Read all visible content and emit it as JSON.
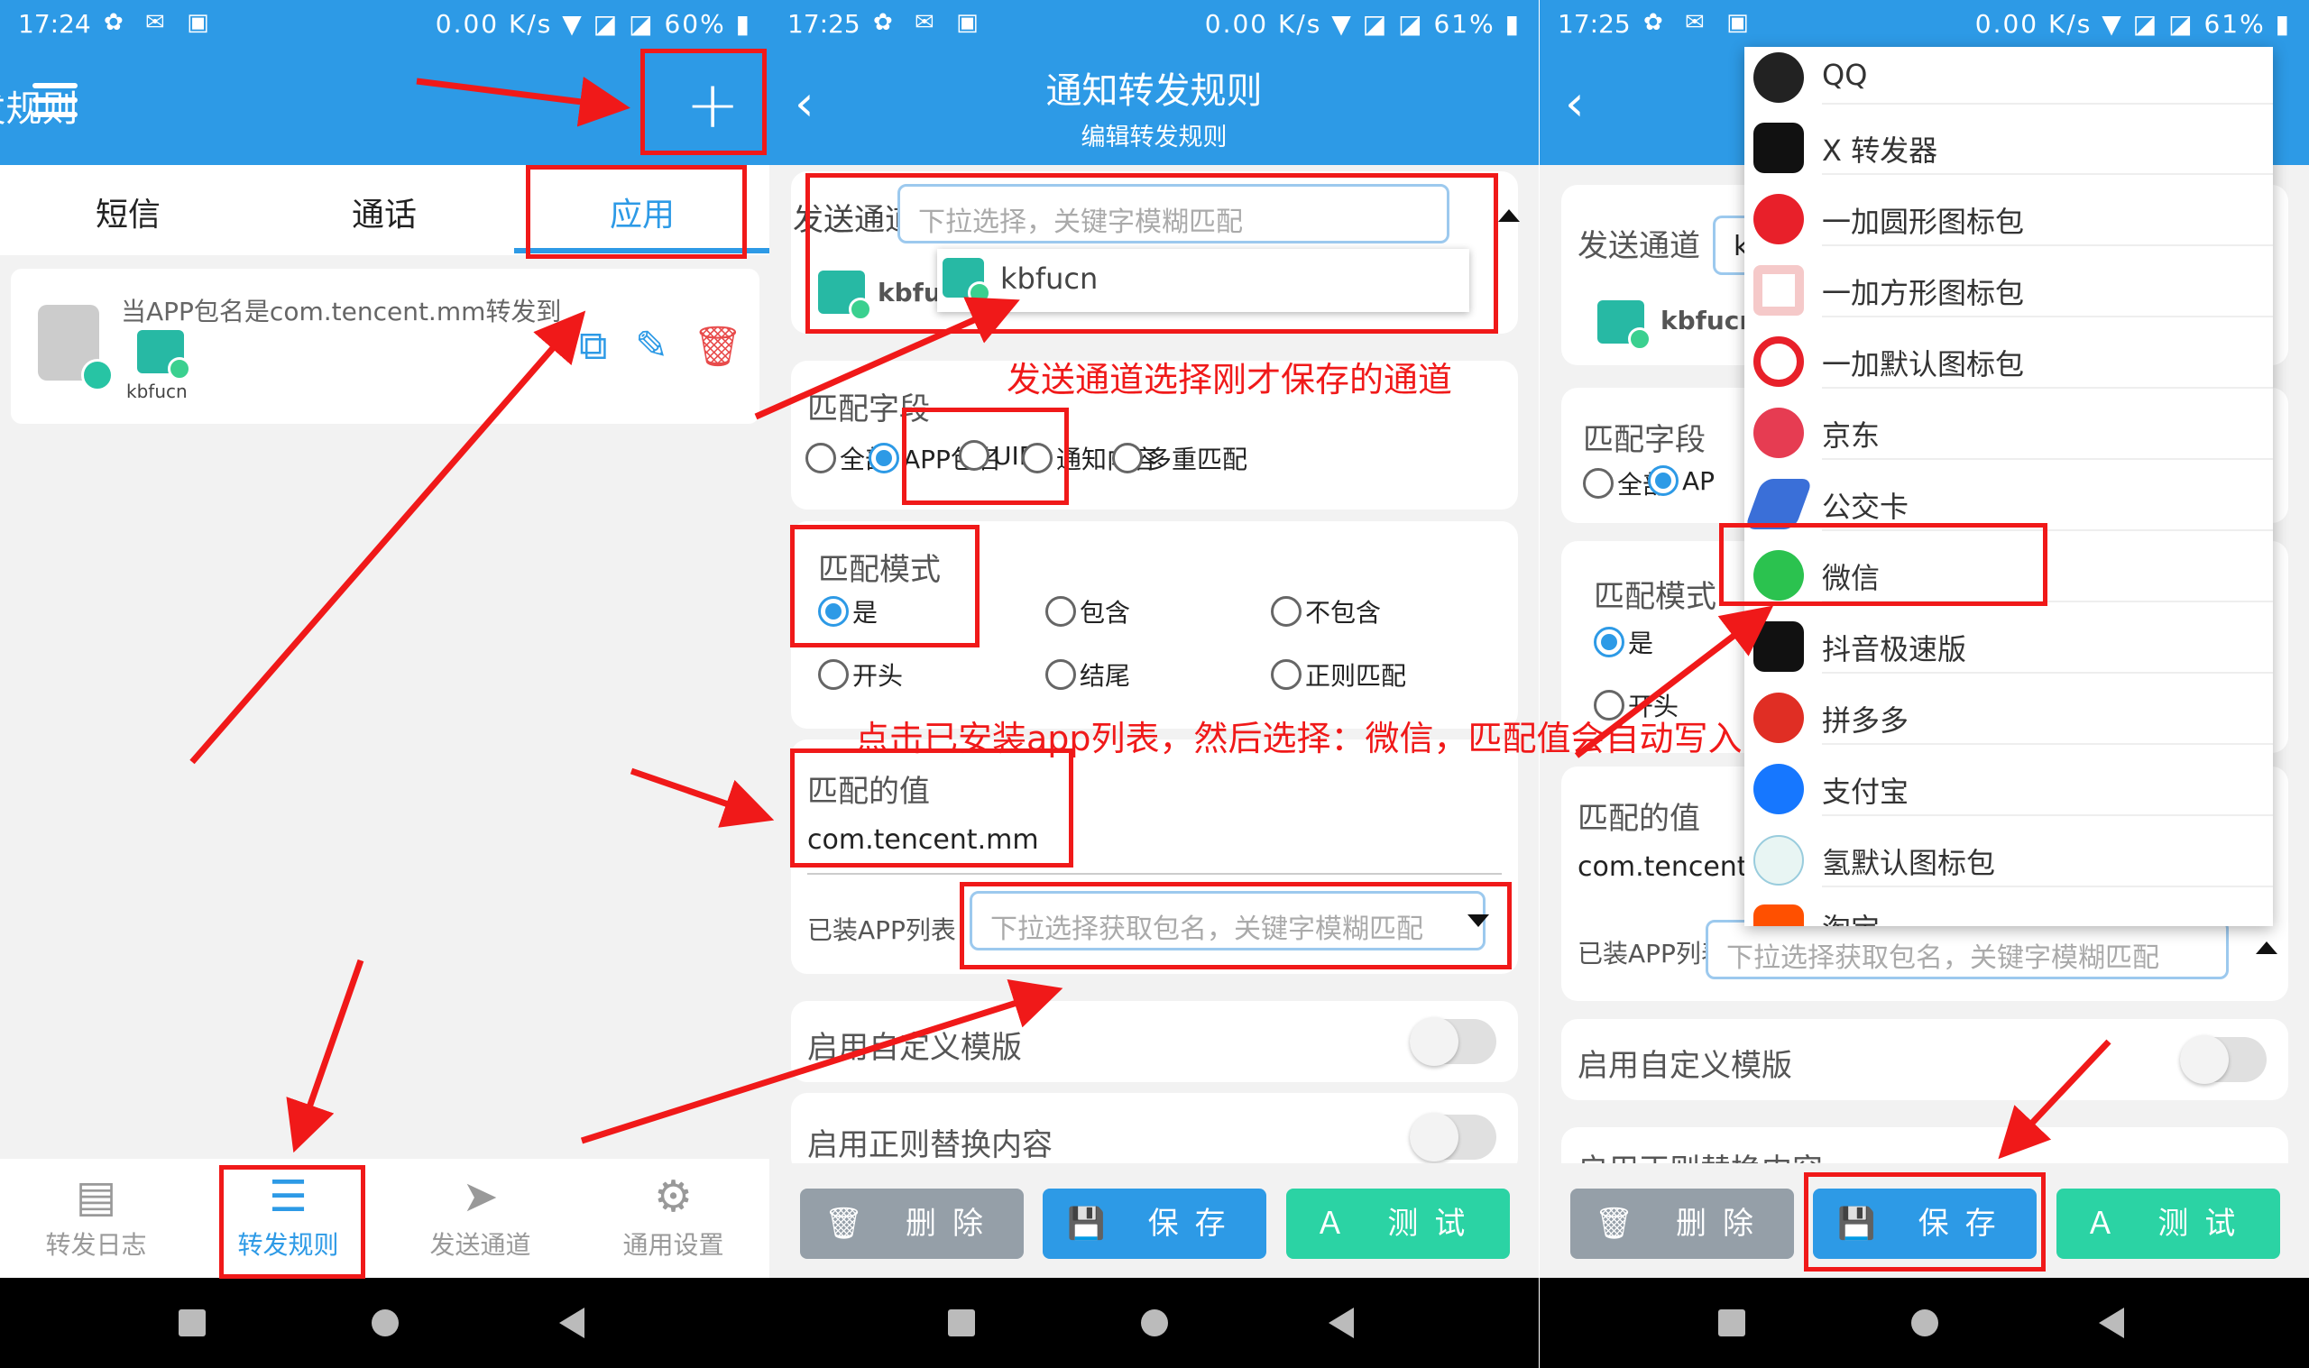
{
  "panel1": {
    "status": {
      "time": "17:24",
      "speed": "0.00 K/s",
      "battery": "60%"
    },
    "title": "转发规则",
    "tabs": [
      "短信",
      "通话",
      "应用"
    ],
    "rule": {
      "text": "当APP包名是com.tencent.mm转发到",
      "channel": "kbfucn"
    },
    "nav": [
      "转发日志",
      "转发规则",
      "发送通道",
      "通用设置"
    ]
  },
  "panel2": {
    "status": {
      "time": "17:25",
      "speed": "0.00 K/s",
      "battery": "61%"
    },
    "title": "通知转发规则",
    "subtitle": "编辑转发规则",
    "channel_label": "发送通道",
    "channel_placeholder": "下拉选择，关键字模糊匹配",
    "channel_option": "kbfucn",
    "channel_partial": "kbfu",
    "field_label": "匹配字段",
    "fields": [
      "全部",
      "APP包名",
      "UID",
      "通知内容",
      "多重匹配"
    ],
    "mode_label": "匹配模式",
    "modes": [
      "是",
      "包含",
      "不包含",
      "开头",
      "结尾",
      "正则匹配"
    ],
    "value_label": "匹配的值",
    "value": "com.tencent.mm",
    "apps_label": "已装APP列表",
    "apps_placeholder": "下拉选择获取包名，关键字模糊匹配",
    "tpl_label": "启用自定义模版",
    "regex_label": "启用正则替换内容",
    "buttons": [
      "删除",
      "保存",
      "测试"
    ]
  },
  "panel3": {
    "status": {
      "time": "17:25",
      "speed": "0.00 K/s",
      "battery": "61%"
    },
    "channel_label": "发送通道",
    "channel_partial": "kbfucn",
    "field_label": "匹配字段",
    "fields": [
      "全部",
      "AP"
    ],
    "mode_label": "匹配模式",
    "modes": [
      "是",
      "开头"
    ],
    "value_label": "匹配的值",
    "value": "com.tencent.",
    "apps_label": "已装APP列表",
    "apps_placeholder": "下拉选择获取包名，关键字模糊匹配",
    "tpl_label": "启用自定义模版",
    "regex_label": "启用正则替换内容",
    "buttons": [
      "删除",
      "保存",
      "测试"
    ],
    "app_list": [
      "QQ",
      "X 转发器",
      "一加圆形图标包",
      "一加方形图标包",
      "一加默认图标包",
      "京东",
      "公交卡",
      "微信",
      "抖音极速版",
      "拼多多",
      "支付宝",
      "氢默认图标包",
      "淘宝"
    ]
  },
  "annotations": {
    "note1": "发送通道选择刚才保存的通道",
    "note2": "点击已安装app列表，然后选择：微信，匹配值会自动写入"
  },
  "colors": {
    "primary": "#2d9ae6",
    "accent": "#2bd3a4",
    "annotation": "#f01919"
  }
}
